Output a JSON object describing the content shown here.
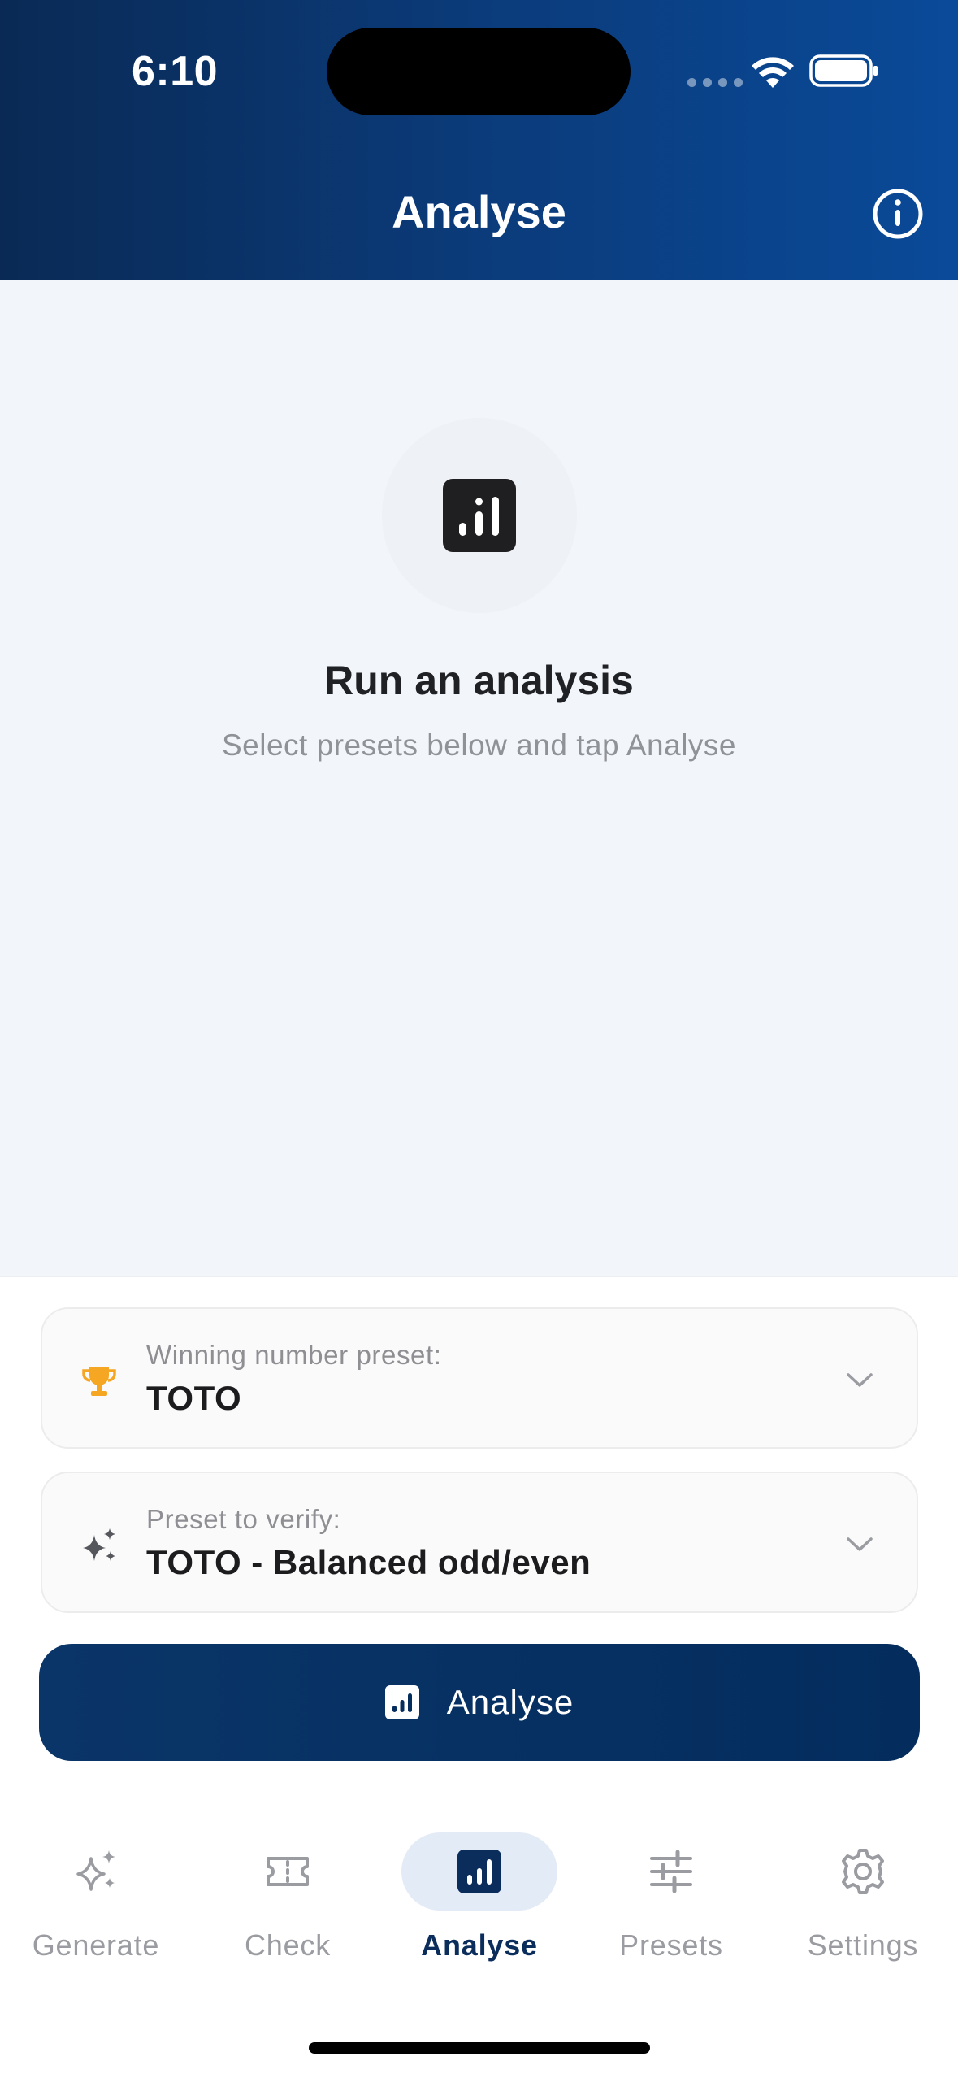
{
  "status_bar": {
    "time": "6:10"
  },
  "header": {
    "title": "Analyse",
    "info_icon": "info-circle-icon"
  },
  "empty_state": {
    "icon": "bar-chart-icon",
    "title": "Run an analysis",
    "subtitle": "Select presets below and tap Analyse"
  },
  "winning_preset": {
    "icon": "trophy-icon",
    "label": "Winning number preset:",
    "value": "TOTO"
  },
  "verify_preset": {
    "icon": "sparkles-icon",
    "label": "Preset to verify:",
    "value": "TOTO - Balanced odd/even"
  },
  "analyse_button": {
    "label": "Analyse",
    "icon": "bar-chart-icon"
  },
  "tabs": [
    {
      "label": "Generate",
      "icon": "sparkles-icon",
      "active": false
    },
    {
      "label": "Check",
      "icon": "ticket-icon",
      "active": false
    },
    {
      "label": "Analyse",
      "icon": "bar-chart-icon",
      "active": true
    },
    {
      "label": "Presets",
      "icon": "sliders-icon",
      "active": false
    },
    {
      "label": "Settings",
      "icon": "gear-icon",
      "active": false
    }
  ],
  "colors": {
    "header_start": "#0a2a55",
    "header_end": "#0a4a99",
    "primary": "#042d5e",
    "trophy": "#f5a623",
    "active_tab_pill": "#e3ebf6"
  }
}
